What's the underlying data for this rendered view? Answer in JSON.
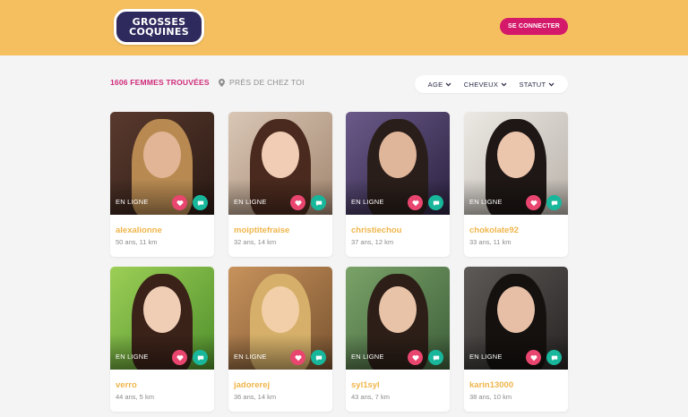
{
  "header": {
    "logo_line1": "GROSSES",
    "logo_line2": "COQUINES",
    "connect_label": "SE CONNECTER"
  },
  "toolbar": {
    "found_label": "1606 FEMMES TROUVÉES",
    "near_label": "PRÈS DE CHEZ TOI",
    "filters": [
      "AGE",
      "CHEVEUX",
      "STATUT"
    ]
  },
  "colors": {
    "header_bg": "#f5bf5f",
    "accent_pink": "#d4186a",
    "name_gold": "#f0b54a",
    "like_red": "#e9466f",
    "chat_teal": "#18b79b"
  },
  "profiles": [
    {
      "status": "EN LIGNE",
      "name": "alexalionne",
      "meta": "50 ans, 11 km"
    },
    {
      "status": "EN LIGNE",
      "name": "moiptitefraise",
      "meta": "32 ans, 14 km"
    },
    {
      "status": "EN LIGNE",
      "name": "christiechou",
      "meta": "37 ans, 12 km"
    },
    {
      "status": "EN LIGNE",
      "name": "chokolate92",
      "meta": "33 ans, 11 km"
    },
    {
      "status": "EN LIGNE",
      "name": "verro",
      "meta": "44 ans, 5 km"
    },
    {
      "status": "EN LIGNE",
      "name": "jadorerej",
      "meta": "36 ans, 14 km"
    },
    {
      "status": "EN LIGNE",
      "name": "syl1syl",
      "meta": "43 ans, 7 km"
    },
    {
      "status": "EN LIGNE",
      "name": "karin13000",
      "meta": "38 ans, 10 km"
    }
  ],
  "icons": {
    "location": "map-pin-icon",
    "chevron": "chevron-down-icon",
    "like": "heart-icon",
    "chat": "chat-bubble-icon"
  }
}
